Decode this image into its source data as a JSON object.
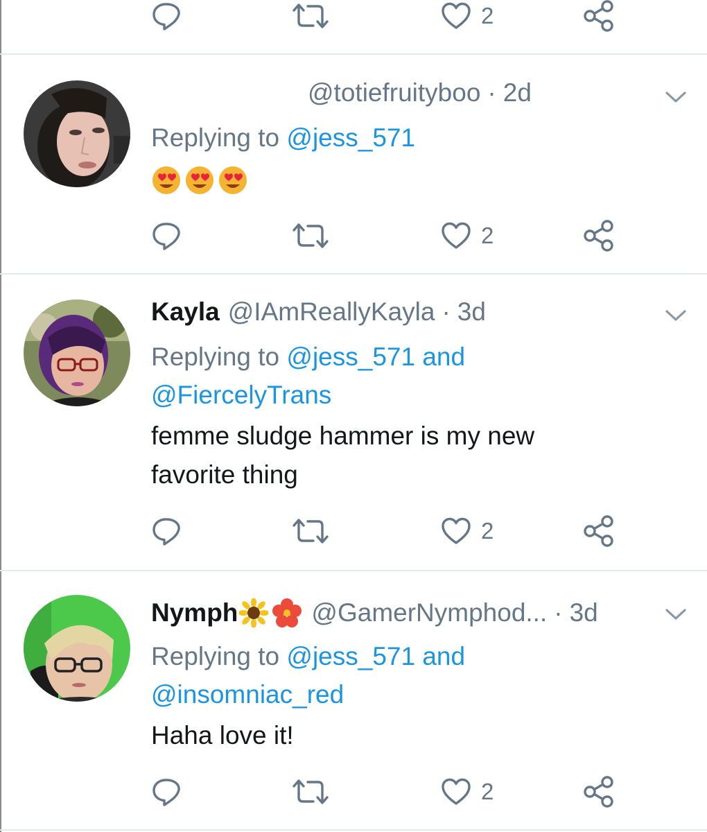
{
  "top_actions": {
    "like_count": "2"
  },
  "replies": [
    {
      "display_name": "",
      "handle": "@totiefruityboo",
      "separator": "·",
      "time": "2d",
      "replying_prefix": "Replying to",
      "mentions_line1": "@jess_571",
      "mentions_line2": "",
      "text": "",
      "emoji": [
        "heart-eyes-emoji",
        "heart-eyes-emoji",
        "heart-eyes-emoji"
      ],
      "like_count": "2"
    },
    {
      "display_name": "Kayla",
      "handle": "@IAmReallyKayla",
      "separator": "·",
      "time": "3d",
      "replying_prefix": "Replying to",
      "mentions_line1": "@jess_571 and",
      "mentions_line2": "@FiercelyTrans",
      "text_line1": "femme sludge hammer is my new",
      "text_line2": "favorite thing",
      "like_count": "2"
    },
    {
      "display_name": "Nymph",
      "display_name_emoji": [
        "sunflower-emoji",
        "hibiscus-emoji"
      ],
      "handle": "@GamerNymphod...",
      "separator": "·",
      "time": "3d",
      "replying_prefix": "Replying to",
      "mentions_line1": "@jess_571 and",
      "mentions_line2": "@insomniac_red",
      "text_line1": "Haha love it!",
      "like_count": "2"
    }
  ],
  "colors": {
    "link": "#1b95e0",
    "secondary": "#657786",
    "primary_text": "#14171a",
    "divider": "#e3e8ec"
  }
}
